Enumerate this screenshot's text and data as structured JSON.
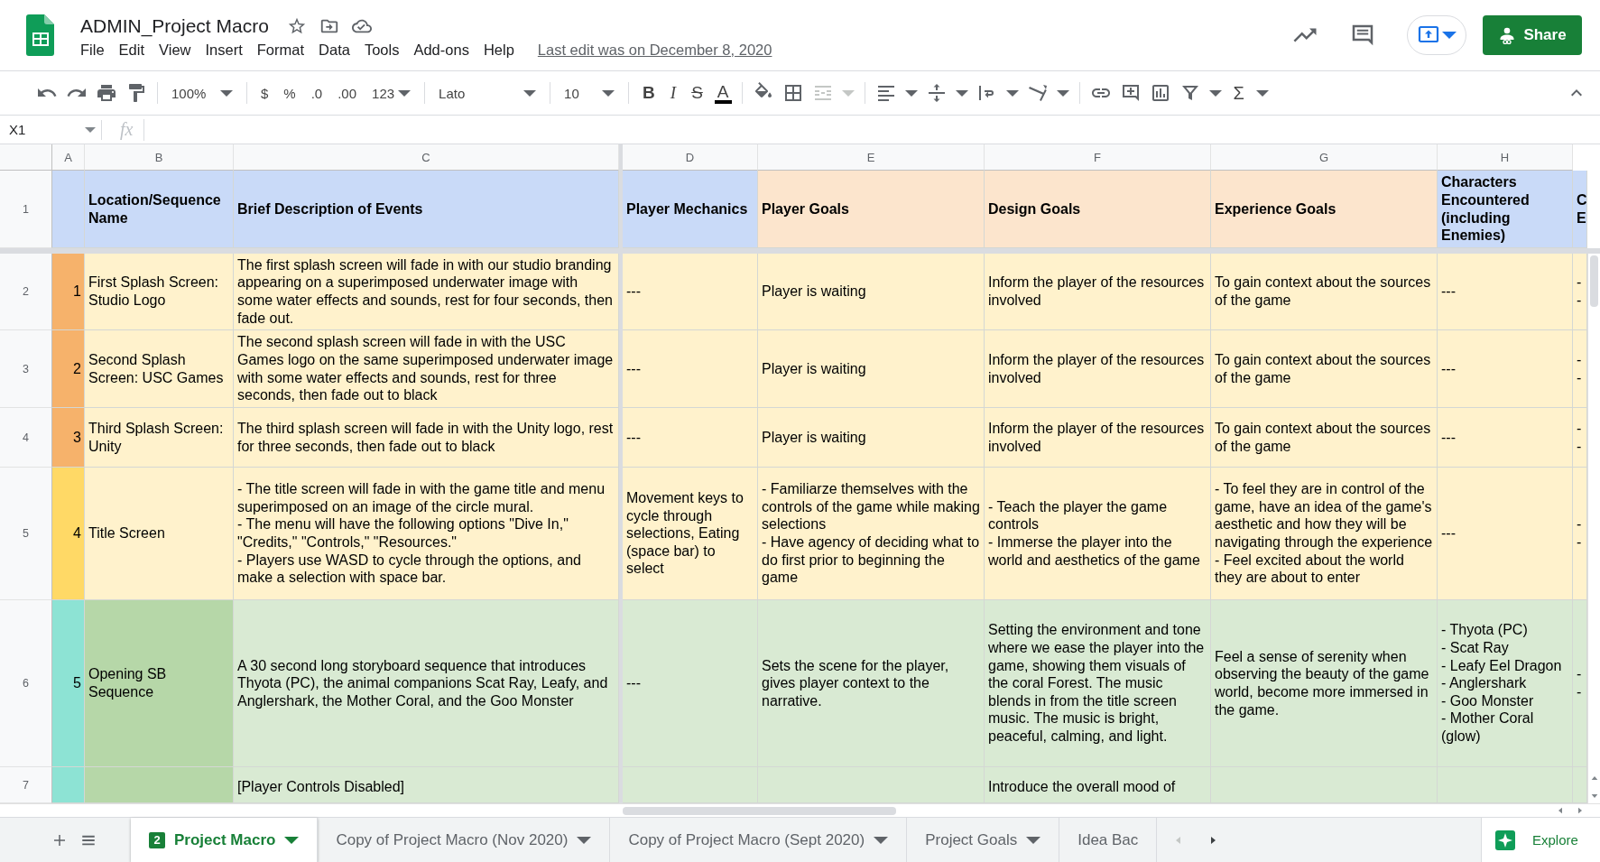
{
  "app": {
    "title": "ADMIN_Project Macro",
    "menu": [
      "File",
      "Edit",
      "View",
      "Insert",
      "Format",
      "Data",
      "Tools",
      "Add-ons",
      "Help"
    ],
    "last_edit": "Last edit was on December 8, 2020",
    "share": "Share"
  },
  "toolbar": {
    "zoom": "100%",
    "currency": "$",
    "percent": "%",
    "decrease_decimals": ".0",
    "increase_decimals": ".00",
    "number_format": "123",
    "font": "Lato",
    "font_size": "10",
    "bold": "B",
    "italic": "I",
    "strikethrough": "S",
    "text_color": "A",
    "merge_disabled": true,
    "functions": "Σ"
  },
  "formula_bar": {
    "cell_ref": "X1",
    "fx": "fx"
  },
  "sheet": {
    "columns": [
      "A",
      "B",
      "C",
      "D",
      "E",
      "F",
      "G",
      "H"
    ],
    "header_row": {
      "number": "1",
      "cells": [
        {
          "color": "#c9daf8"
        },
        {
          "text": "Location/Sequence Name",
          "color": "#c9daf8"
        },
        {
          "text": "Brief Description of Events",
          "color": "#c9daf8"
        },
        {
          "text": "Player Mechanics",
          "color": "#c9daf8"
        },
        {
          "text": "Player Goals",
          "color": "#fce5cd"
        },
        {
          "text": "Design Goals",
          "color": "#fce5cd"
        },
        {
          "text": "Experience Goals",
          "color": "#fce5cd"
        },
        {
          "text": "Characters Encountered (including Enemies)",
          "color": "#c9daf8"
        },
        {
          "text": "C\nE",
          "color": "#c9daf8"
        }
      ]
    },
    "rows": [
      {
        "number": "2",
        "cells": [
          {
            "text": "1",
            "color": "#f6b26b"
          },
          {
            "text": "First Splash Screen: Studio Logo",
            "color": "#fff2cc"
          },
          {
            "text": "The first splash screen will fade in with our studio branding appearing on a superimposed underwater image with some water effects and sounds, rest for four seconds, then fade out.",
            "color": "#fff2cc"
          },
          {
            "text": "---",
            "color": "#fff2cc"
          },
          {
            "text": "Player is waiting",
            "color": "#fff2cc"
          },
          {
            "text": "Inform the player of the resources involved",
            "color": "#fff2cc"
          },
          {
            "text": "To gain context about the sources of the game",
            "color": "#fff2cc"
          },
          {
            "text": "---",
            "color": "#fff2cc"
          },
          {
            "text": "--",
            "color": "#fff2cc"
          }
        ]
      },
      {
        "number": "3",
        "cells": [
          {
            "text": "2",
            "color": "#f6b26b"
          },
          {
            "text": "Second Splash Screen: USC Games",
            "color": "#fff2cc"
          },
          {
            "text": "The second splash screen will fade in with the USC Games logo on the same superimposed underwater image with some water effects and sounds, rest for three seconds, then fade out to black",
            "color": "#fff2cc"
          },
          {
            "text": "---",
            "color": "#fff2cc"
          },
          {
            "text": "Player is waiting",
            "color": "#fff2cc"
          },
          {
            "text": "Inform the player of the resources involved",
            "color": "#fff2cc"
          },
          {
            "text": "To gain context about the sources of the game",
            "color": "#fff2cc"
          },
          {
            "text": "---",
            "color": "#fff2cc"
          },
          {
            "text": "--",
            "color": "#fff2cc"
          }
        ]
      },
      {
        "number": "4",
        "cells": [
          {
            "text": "3",
            "color": "#f6b26b"
          },
          {
            "text": "Third Splash Screen: Unity",
            "color": "#fff2cc"
          },
          {
            "text": "The third splash screen will fade in with the Unity logo, rest for three seconds, then fade out to black",
            "color": "#fff2cc"
          },
          {
            "text": "---",
            "color": "#fff2cc"
          },
          {
            "text": "Player is waiting",
            "color": "#fff2cc"
          },
          {
            "text": "Inform the player of the resources involved",
            "color": "#fff2cc"
          },
          {
            "text": "To gain context about the sources of the game",
            "color": "#fff2cc"
          },
          {
            "text": "---",
            "color": "#fff2cc"
          },
          {
            "text": "--",
            "color": "#fff2cc"
          }
        ]
      },
      {
        "number": "5",
        "cells": [
          {
            "text": "4",
            "color": "#ffd966"
          },
          {
            "text": "Title Screen",
            "color": "#fff2cc"
          },
          {
            "text": "- The title screen will fade in with the game title and menu superimposed on an image of the circle mural.\n- The menu will have the following options \"Dive In,\" \"Credits,\" \"Controls,\" \"Resources.\"\n- Players use WASD to cycle through the options, and make a selection with space bar.",
            "color": "#fff2cc"
          },
          {
            "text": "Movement keys to cycle through selections, Eating (space bar) to select",
            "color": "#fff2cc"
          },
          {
            "text": "- Familiarze themselves with the controls of the game while making selections\n- Have agency of deciding what to do first prior to beginning the game",
            "color": "#fff2cc"
          },
          {
            "text": "- Teach the player the game controls\n- Immerse the player into the world and aesthetics of the game",
            "color": "#fff2cc"
          },
          {
            "text": "- To feel they are in control of the game, have an idea of the game's aesthetic and how they will be navigating through the experience\n- Feel excited about the world they are about to enter",
            "color": "#fff2cc"
          },
          {
            "text": "---",
            "color": "#fff2cc"
          },
          {
            "text": "--",
            "color": "#fff2cc"
          }
        ]
      },
      {
        "number": "6",
        "cells": [
          {
            "text": "5",
            "color": "#8de3d4"
          },
          {
            "text": "Opening SB Sequence",
            "color": "#b6d7a8"
          },
          {
            "text": "A 30 second long storyboard sequence that introduces Thyota (PC), the animal companions Scat Ray, Leafy, and Anglershark, the Mother Coral, and the Goo Monster",
            "color": "#d9ead3"
          },
          {
            "text": "---",
            "color": "#d9ead3"
          },
          {
            "text": "Sets the scene for the player, gives player context to the narrative.",
            "color": "#d9ead3"
          },
          {
            "text": "Setting the environment and tone where we ease the player into the game, showing them visuals of the coral Forest. The music blends in from the title screen music. The music is bright, peaceful, calming, and light.",
            "color": "#d9ead3"
          },
          {
            "text": "Feel a sense of serenity when observing the beauty of the game world, become more immersed in the game.",
            "color": "#d9ead3"
          },
          {
            "text": "- Thyota (PC)\n- Scat Ray\n- Leafy Eel Dragon\n- Anglershark\n- Goo Monster\n- Mother Coral (glow)",
            "color": "#d9ead3"
          },
          {
            "text": "--",
            "color": "#d9ead3"
          }
        ]
      },
      {
        "number": "7",
        "cells": [
          {
            "color": "#8de3d4"
          },
          {
            "color": "#b6d7a8"
          },
          {
            "text": "[Player Controls Disabled]",
            "color": "#d9ead3"
          },
          {
            "color": "#d9ead3"
          },
          {
            "color": "#d9ead3"
          },
          {
            "text": "Introduce the overall mood of",
            "color": "#d9ead3"
          },
          {
            "color": "#d9ead3"
          },
          {
            "color": "#d9ead3"
          },
          {
            "color": "#d9ead3"
          }
        ]
      }
    ]
  },
  "tabs": [
    {
      "label": "Project Macro",
      "selected": true,
      "badge": "2"
    },
    {
      "label": "Copy of Project Macro (Nov 2020)",
      "selected": false
    },
    {
      "label": "Copy of Project Macro (Sept 2020)",
      "selected": false
    },
    {
      "label": "Project Goals",
      "selected": false
    },
    {
      "label": "Idea Bac",
      "selected": false
    }
  ],
  "explore": "Explore"
}
